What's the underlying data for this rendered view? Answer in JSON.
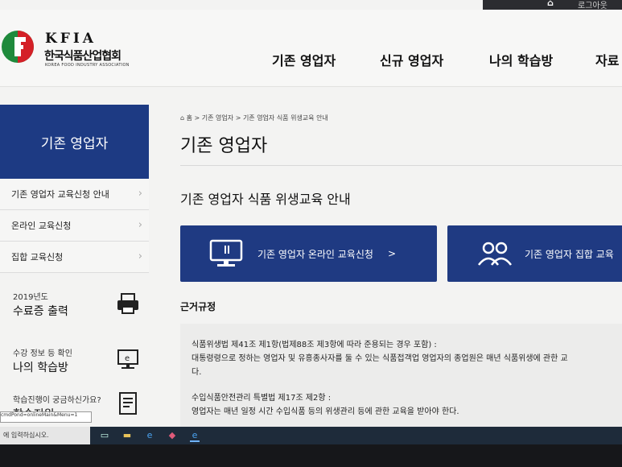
{
  "topbar": {
    "icon": "home-icon",
    "logout_label": "로그아웃"
  },
  "logo": {
    "en": "KFIA",
    "ko": "한국식품산업협회",
    "sub": "KOREA FOOD INDUSTRY ASSOCIATION"
  },
  "nav": {
    "items": [
      "기존 영업자",
      "신규 영업자",
      "나의 학습방",
      "자료"
    ]
  },
  "sidebar": {
    "title": "기존 영업자",
    "items": [
      "기존 영업자 교육신청 안내",
      "온라인 교육신청",
      "집합 교육신청"
    ],
    "boxes": [
      {
        "line1": "2019년도",
        "line2": "수료증 출력",
        "icon": "printer-icon"
      },
      {
        "line1": "수강 정보 등 확인",
        "line2": "나의 학습방",
        "icon": "monitor-icon"
      },
      {
        "line1": "학습진행이 궁금하신가요?",
        "line2": "학습지원",
        "icon": "document-icon"
      }
    ]
  },
  "breadcrumb": {
    "icon": "home-icon",
    "home": "홈",
    "level1": "기존 영업자",
    "level2": "기존 영업자 식품 위생교육 안내"
  },
  "main": {
    "title": "기존 영업자",
    "subtitle": "기존 영업자 식품 위생교육 안내",
    "online_button": "기존 영업자 온라인 교육신청",
    "online_arrow": ">",
    "group_button": "기존 영업자 집합 교육",
    "section_label": "근거규정",
    "law1_title": "식품위생법 제41조 제1항(법제88조 제3항에 따라 준용되는 경우 포함) :",
    "law1_body": "대통령령으로 정하는 영업자 및 유흥종사자를 둘 수 있는 식품접객업 영업자의 종업원은 매년 식품위생에 관한 교",
    "law1_body2": "다.",
    "law2_title": "수입식품안전관리 특별법 제17조 제2항 :",
    "law2_body": "영업자는 매년 일정 시간 수입식품 등의 위생관리 등에 관한 교육을 받아야 한다."
  },
  "status_tooltip": "cmdPond=onlineMain&Menu=1",
  "taskbar": {
    "search_placeholder": "에 입력하십시오."
  },
  "colors": {
    "brand_blue": "#1f3a82",
    "logo_green": "#1f8a3c",
    "logo_red": "#d42027"
  }
}
